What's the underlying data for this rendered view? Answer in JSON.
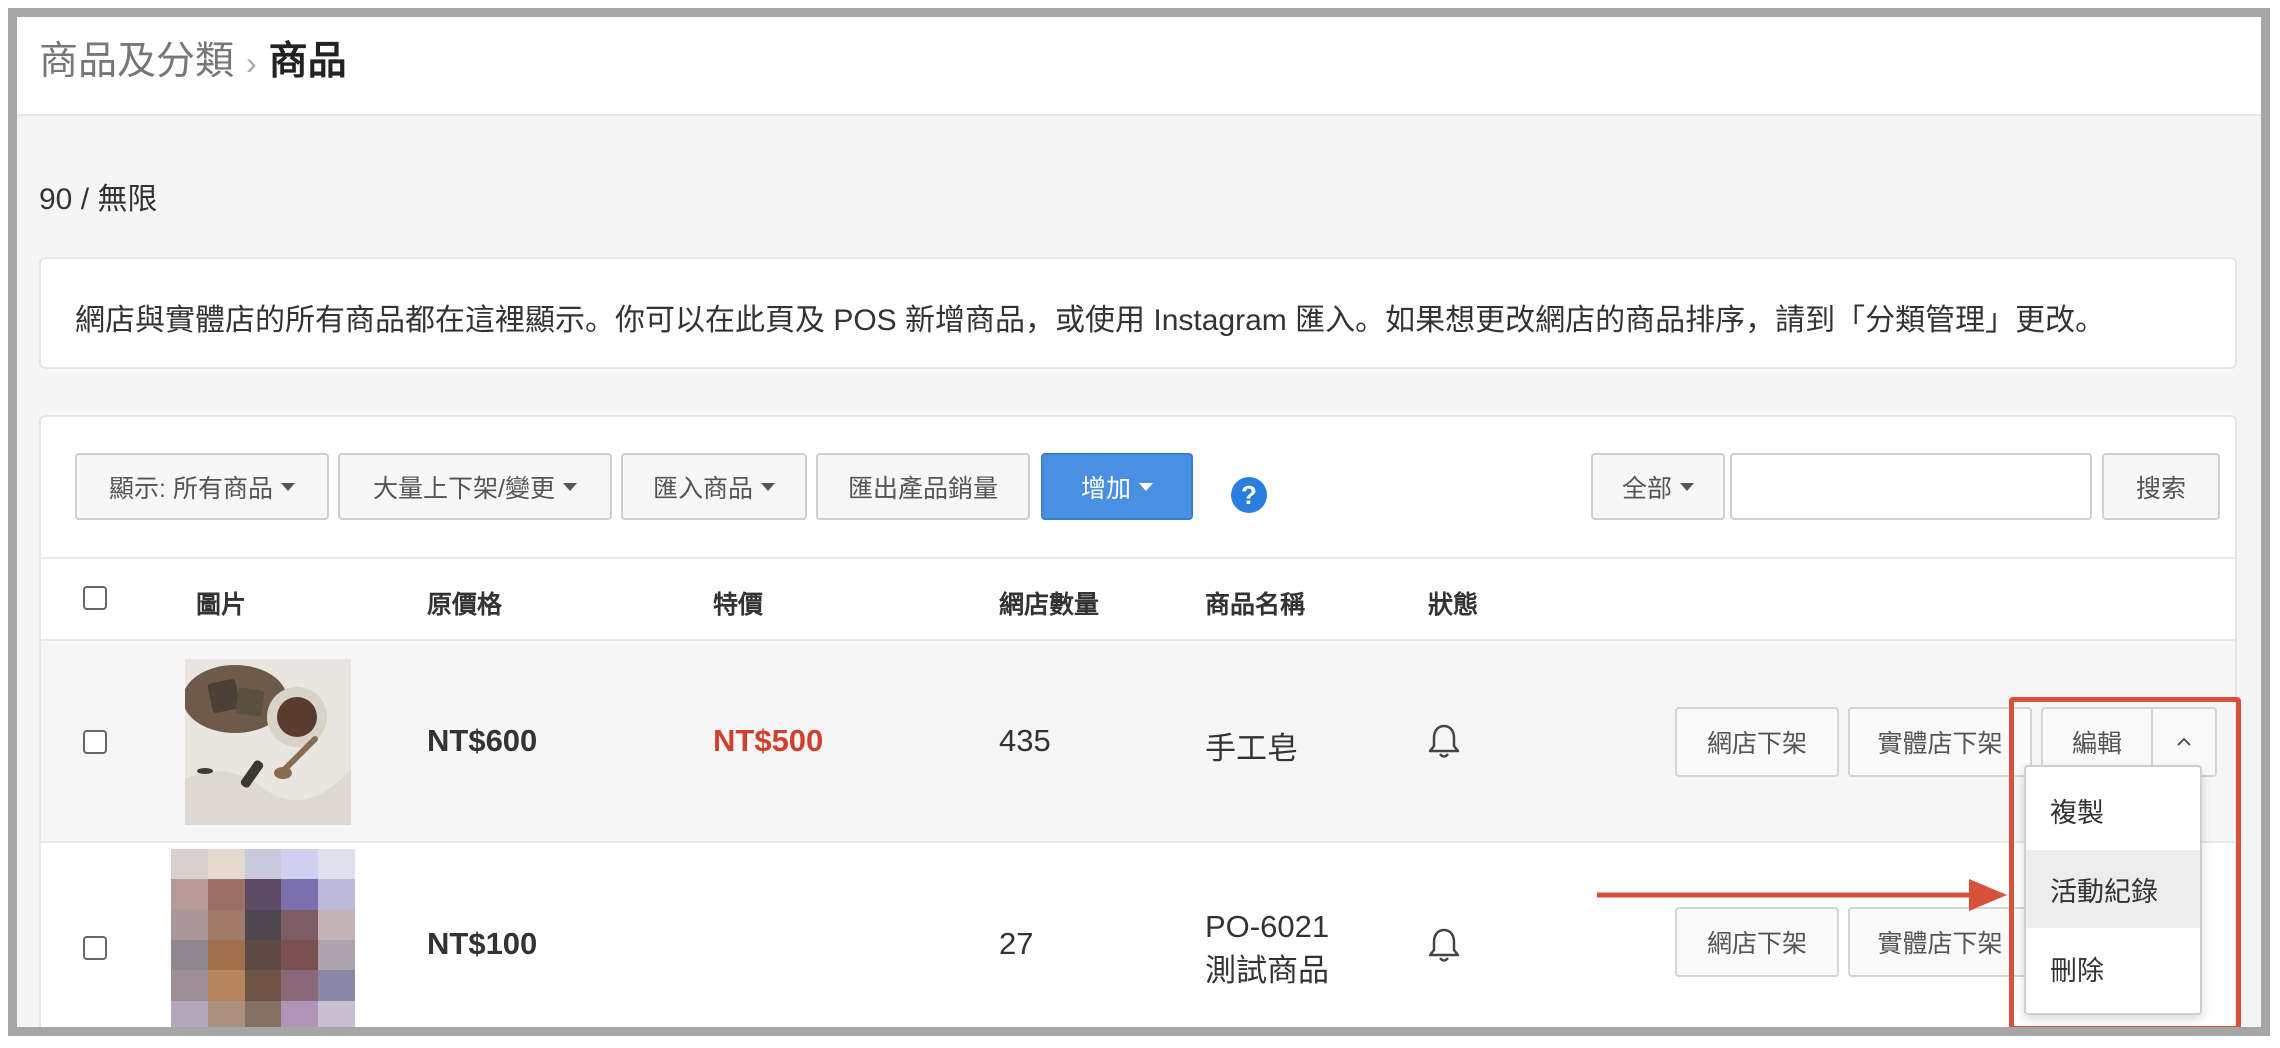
{
  "breadcrumb": {
    "parent": "商品及分類",
    "separator": "›",
    "current": "商品"
  },
  "usage": "90 / 無限",
  "info": "網店與實體店的所有商品都在這裡顯示。你可以在此頁及 POS 新增商品，或使用 Instagram 匯入。如果想更改網店的商品排序，請到「分類管理」更改。",
  "toolbar": {
    "filter_label": "顯示: 所有商品",
    "bulk_label": "大量上下架/變更",
    "import_label": "匯入商品",
    "export_label": "匯出產品銷量",
    "add_label": "增加",
    "help": "?",
    "scope_label": "全部",
    "search_value": "",
    "search_label": "搜索"
  },
  "table": {
    "headers": {
      "image": "圖片",
      "price": "原價格",
      "sale": "特價",
      "stock": "網店數量",
      "name": "商品名稱",
      "status": "狀態"
    },
    "rows": [
      {
        "price": "NT$600",
        "sale": "NT$500",
        "stock": "435",
        "name": "手工皂",
        "status_icon": "bell-icon",
        "online_off": "網店下架",
        "store_off": "實體店下架",
        "edit": "編輯"
      },
      {
        "price": "NT$100",
        "sale": "",
        "stock": "27",
        "name_line1": "PO-6021",
        "name_line2": "測試商品",
        "status_icon": "bell-icon",
        "online_off": "網店下架",
        "store_off": "實體店下架"
      }
    ]
  },
  "dropdown": {
    "items": [
      "複製",
      "活動紀錄",
      "刪除"
    ]
  },
  "colors": {
    "primary": "#4a90e2",
    "sale": "#d0402f",
    "highlight": "#d8513b"
  }
}
